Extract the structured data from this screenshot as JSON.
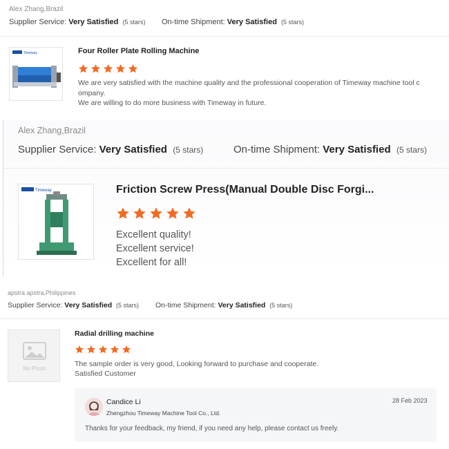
{
  "colors": {
    "star": "#f26b22",
    "separator": "#e8e8e8",
    "reply_bg": "#f5f6f8"
  },
  "reviews": [
    {
      "reviewer": "Alex Zhang,Brazil",
      "supplier_label": "Supplier Service:",
      "supplier_value": "Very Satisfied",
      "supplier_stars": "(5 stars)",
      "shipment_label": "On-time Shipment:",
      "shipment_value": "Very Satisfied",
      "shipment_stars": "(5 stars)",
      "product_title": "Four Roller Plate Rolling Machine",
      "rating": 5,
      "comment_lines": [
        "We are very satisfied with the machine quality and the professional cooperation of Timeway machine tool c",
        "ompany.",
        "We are willing to do more business with Timeway in future."
      ],
      "thumb_brand": "Timeway"
    },
    {
      "reviewer": "Alex Zhang,Brazil",
      "supplier_label": "Supplier Service:",
      "supplier_value": "Very Satisfied",
      "supplier_stars": "(5 stars)",
      "shipment_label": "On-time Shipment:",
      "shipment_value": "Very Satisfied",
      "shipment_stars": "(5 stars)",
      "product_title": "Friction Screw Press(Manual Double Disc Forgi...",
      "rating": 5,
      "comment_lines": [
        "Excellent quality!",
        "Excellent service!",
        "Excellent for all!"
      ],
      "thumb_brand": "Timeway"
    },
    {
      "reviewer": "apstra apstra,Philippines",
      "supplier_label": "Supplier Service:",
      "supplier_value": "Very Satisfied",
      "supplier_stars": "(5 stars)",
      "shipment_label": "On-time Shipment:",
      "shipment_value": "Very Satisfied",
      "shipment_stars": "(5 stars)",
      "product_title": "Radial drilling machine",
      "rating": 5,
      "comment_lines": [
        "The sample order is very good, Looking forward to purchase and cooperate.",
        "Satisfied Customer"
      ],
      "no_photo_label": "No Photo"
    }
  ],
  "reply": {
    "name": "Candice Li",
    "company": "Zhengzhou Timeway Machine Tool Co., Ltd.",
    "date": "28 Feb 2023",
    "message": "Thanks for your feedback, my friend, if you need any help, please contact us freely."
  }
}
